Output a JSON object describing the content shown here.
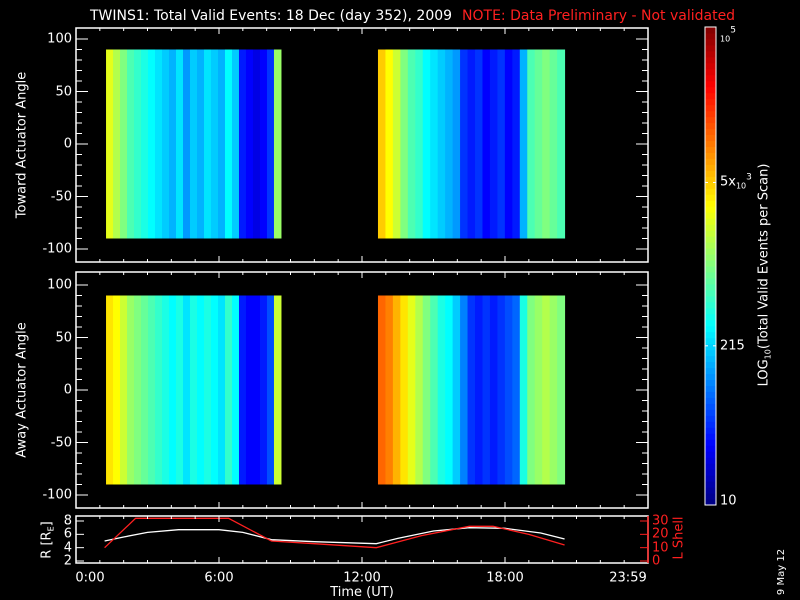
{
  "title": {
    "main": "TWINS1: Total Valid Events: 18 Dec (day 352), 2009",
    "note": "NOTE: Data Preliminary - Not validated"
  },
  "date_stamp": "9 May 12",
  "chart_data": [
    {
      "type": "heatmap",
      "name": "toward",
      "ylabel": "Toward Actuator Angle",
      "ylim": [
        -112,
        110
      ],
      "yticks": [
        "100",
        "50",
        "0",
        "-50",
        "-100"
      ],
      "yvals": [
        100,
        50,
        0,
        -50,
        -100
      ],
      "angle_range": [
        -90,
        90
      ],
      "blocks": [
        {
          "t0": 1.26,
          "t1": 8.6,
          "log_values": [
            3.4,
            3.2,
            3.0,
            2.8,
            2.7,
            2.6,
            2.5,
            2.4,
            2.3,
            2.2,
            2.4,
            2.1,
            2.3,
            2.2,
            2.4,
            2.3,
            2.2,
            2.5,
            2.3,
            1.6,
            1.5,
            1.4,
            1.5,
            1.7,
            3.1
          ]
        },
        {
          "t0": 12.67,
          "t1": 20.5,
          "log_values": [
            3.7,
            3.5,
            3.3,
            3.0,
            2.8,
            2.7,
            2.5,
            2.4,
            2.3,
            2.2,
            2.1,
            1.7,
            1.6,
            1.7,
            1.5,
            1.6,
            1.7,
            1.5,
            1.6,
            2.2,
            2.8,
            2.9,
            3.0,
            2.9,
            2.8
          ]
        }
      ]
    },
    {
      "type": "heatmap",
      "name": "away",
      "ylabel": "Away Actuator Angle",
      "ylim": [
        -112,
        110
      ],
      "yticks": [
        "100",
        "50",
        "0",
        "-50",
        "-100"
      ],
      "yvals": [
        100,
        50,
        0,
        -50,
        -100
      ],
      "angle_range": [
        -90,
        90
      ],
      "blocks": [
        {
          "t0": 1.26,
          "t1": 8.6,
          "log_values": [
            3.6,
            3.5,
            3.3,
            3.1,
            3.0,
            2.9,
            2.8,
            2.7,
            2.6,
            2.5,
            2.6,
            2.4,
            2.6,
            2.5,
            2.6,
            2.5,
            2.4,
            2.7,
            2.5,
            1.6,
            1.5,
            1.5,
            1.6,
            1.8,
            3.3
          ]
        },
        {
          "t0": 12.67,
          "t1": 20.5,
          "log_values": [
            4.1,
            4.0,
            3.8,
            3.6,
            3.4,
            3.2,
            3.0,
            2.8,
            2.6,
            2.5,
            2.3,
            2.0,
            1.7,
            1.6,
            1.7,
            1.6,
            1.7,
            1.8,
            1.9,
            2.6,
            3.0,
            3.1,
            3.2,
            3.1,
            3.0
          ]
        }
      ]
    },
    {
      "type": "line",
      "name": "orbit",
      "xlabel": "Time (UT)",
      "xticks": [
        "0:00",
        "6:00",
        "12:00",
        "18:00",
        "23:59"
      ],
      "xvals": [
        0,
        6,
        12,
        18,
        24
      ],
      "xlim": [
        0,
        24
      ],
      "ylabel_left": {
        "pre": "R [R",
        "sub": "E",
        "post": "]"
      },
      "ylabel_right": "L Shell",
      "yticks_left": [
        "2",
        "4",
        "6",
        "8"
      ],
      "yvals_left": [
        2,
        4,
        6,
        8
      ],
      "ylim_left": [
        2,
        8
      ],
      "yticks_right": [
        "0",
        "10",
        "20",
        "30"
      ],
      "yvals_right": [
        0,
        10,
        20,
        30
      ],
      "ylim_right": [
        0,
        30
      ],
      "series": [
        {
          "name": "R",
          "color": "#ffffff",
          "x": [
            1.2,
            2,
            3,
            4.3,
            6,
            7,
            8.2,
            10,
            12.6,
            13.5,
            15,
            16.5,
            18,
            19.5,
            20.5
          ],
          "y": [
            5.0,
            5.6,
            6.3,
            6.7,
            6.7,
            6.3,
            5.2,
            4.9,
            4.6,
            5.4,
            6.5,
            7.0,
            6.9,
            6.2,
            5.3
          ]
        },
        {
          "name": "L Shell",
          "color": "#ff2020",
          "x": [
            1.2,
            2.5,
            6.4,
            8.2,
            10,
            12.6,
            14.5,
            16.5,
            17.5,
            19,
            20.5
          ],
          "y": [
            10,
            32,
            32,
            15,
            13,
            10,
            19,
            26,
            26,
            20,
            12
          ]
        }
      ]
    }
  ],
  "colorbar": {
    "label_pre": "LOG",
    "label_sub": "10",
    "label_post": "(Total Valid Events per Scan)",
    "log_range": [
      1,
      5
    ],
    "ticks": [
      {
        "log": 5,
        "base": "10",
        "exp": "5",
        "prefix": ""
      },
      {
        "log": 3.699,
        "base": "10",
        "exp": "3",
        "prefix": "5x"
      },
      {
        "log": 2.332,
        "text": "215"
      },
      {
        "log": 1,
        "text": "10"
      }
    ]
  }
}
